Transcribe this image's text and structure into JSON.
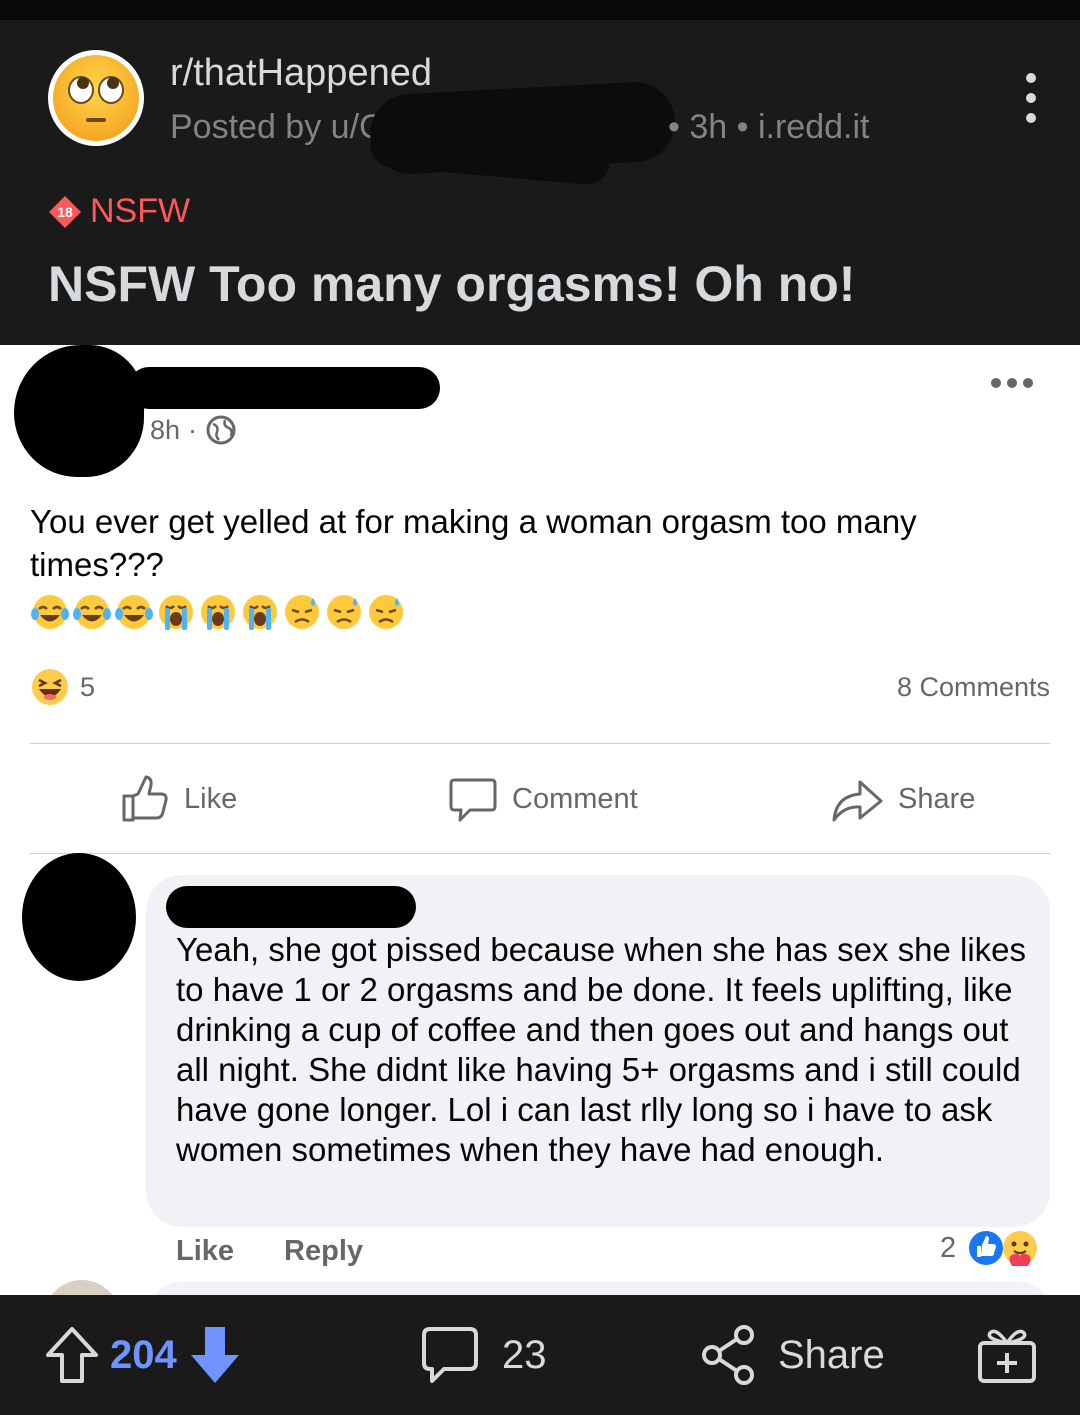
{
  "reddit": {
    "subreddit": "r/thatHappened",
    "posted_by_prefix": "Posted by u/C",
    "meta_after": "• 3h • i.redd.it",
    "nsfw_badge_number": "18",
    "nsfw_label": "NSFW",
    "title": "NSFW Too many orgasms! Oh no!",
    "bottom_bar": {
      "vote_count": "204",
      "comment_count": "23",
      "share_label": "Share"
    }
  },
  "fb_post": {
    "time": "8h",
    "text": "You ever get yelled at for making a woman orgasm too many times???",
    "emoji_row": [
      "tears-of-joy",
      "tears-of-joy",
      "tears-of-joy",
      "loudly-crying",
      "loudly-crying",
      "loudly-crying",
      "downcast-sweat",
      "downcast-sweat",
      "downcast-sweat"
    ],
    "reaction_count": "5",
    "comments_count": "8 Comments",
    "actions": {
      "like": "Like",
      "comment": "Comment",
      "share": "Share"
    }
  },
  "fb_comment": {
    "text": "Yeah, she got pissed because when she has sex she likes to have 1 or 2 orgasms and be done. It feels uplifting, like drinking a cup of coffee and then goes out and hangs out all night. She didnt like having 5+ orgasms and i still could have gone longer. Lol i can last rlly long so i have to ask women sometimes when they have had enough.",
    "like_label": "Like",
    "reply_label": "Reply",
    "reaction_count": "2"
  },
  "colors": {
    "reddit_bg": "#1a1a1b",
    "reddit_text": "#d7dadc",
    "reddit_muted": "#818384",
    "nsfw_red": "#ff585b",
    "upvote_blue": "#7193ff",
    "fb_text": "#050505",
    "fb_muted": "#65676b",
    "fb_bubble": "#f0f2f5",
    "fb_blue": "#1877f2"
  }
}
